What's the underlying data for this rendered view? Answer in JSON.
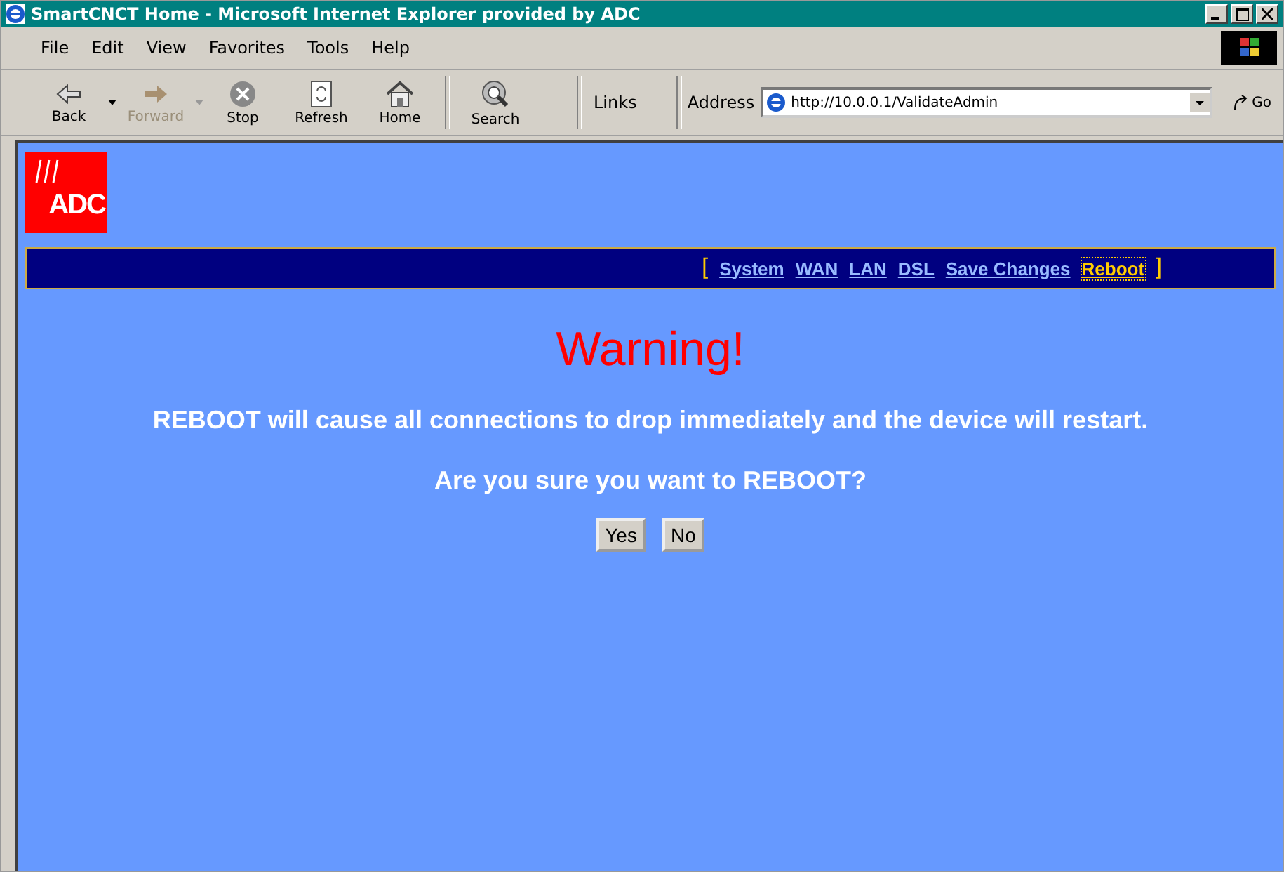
{
  "window": {
    "title": "SmartCNCT Home - Microsoft Internet Explorer provided by ADC"
  },
  "menu": [
    "File",
    "Edit",
    "View",
    "Favorites",
    "Tools",
    "Help"
  ],
  "toolbar": [
    {
      "kind": "back",
      "label": "Back",
      "disabled": false,
      "dropdown": true
    },
    {
      "kind": "forward",
      "label": "Forward",
      "disabled": true,
      "dropdown": true
    },
    {
      "kind": "stop",
      "label": "Stop",
      "disabled": false,
      "dropdown": false
    },
    {
      "kind": "refresh",
      "label": "Refresh",
      "disabled": false,
      "dropdown": false
    },
    {
      "kind": "home",
      "label": "Home",
      "disabled": false,
      "dropdown": false
    },
    {
      "kind": "search",
      "label": "Search",
      "disabled": false,
      "dropdown": false
    }
  ],
  "links": {
    "label": "Links"
  },
  "address": {
    "label": "Address",
    "value": "http://10.0.0.1/ValidateAdmin",
    "go": "Go"
  },
  "page": {
    "logo": "ADC",
    "nav_brackets": [
      "[",
      "]"
    ],
    "nav": [
      {
        "label": "System",
        "selected": false
      },
      {
        "label": "WAN",
        "selected": false
      },
      {
        "label": "LAN",
        "selected": false
      },
      {
        "label": "DSL",
        "selected": false
      },
      {
        "label": "Save Changes",
        "selected": false
      },
      {
        "label": "Reboot",
        "selected": true
      }
    ],
    "heading": "Warning!",
    "message": "REBOOT will cause all connections to drop immediately and the device will restart.",
    "question": "Are you sure you want to REBOOT?",
    "buttons": [
      "Yes",
      "No"
    ]
  }
}
